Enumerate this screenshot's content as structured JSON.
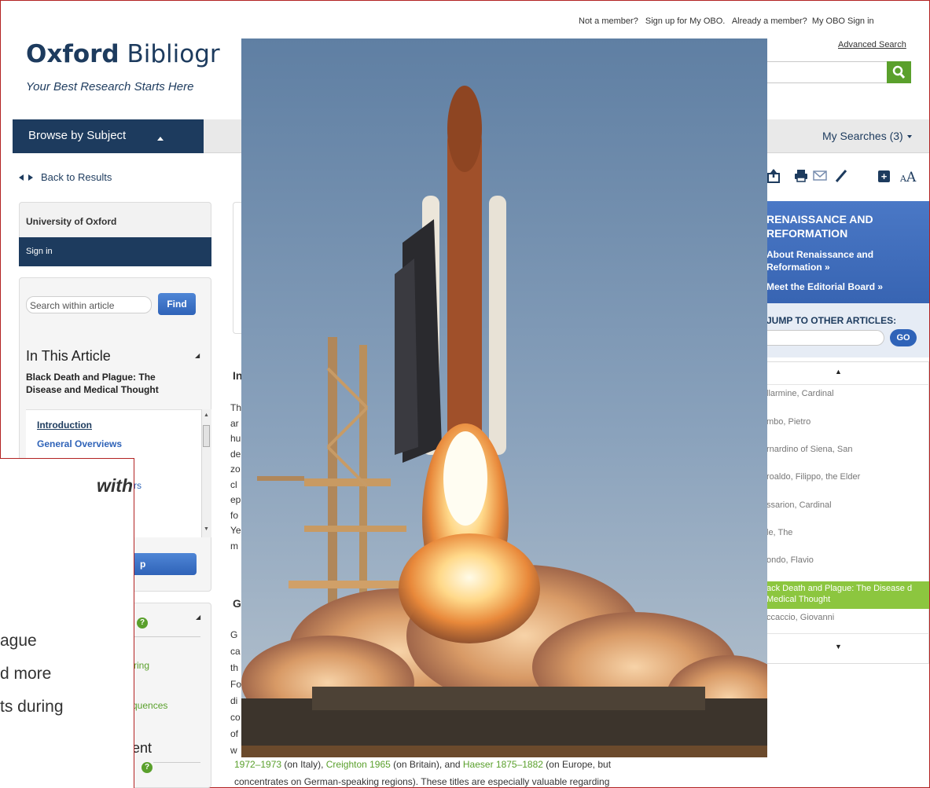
{
  "header": {
    "not_member": "Not a member?",
    "sign_up": "Sign up for My OBO.",
    "already_member": "Already a member?",
    "sign_in": "My OBO Sign in",
    "advanced_search": "Advanced Search",
    "logo_bold": "Oxford",
    "logo_rest": " Bibliogr",
    "tagline": "Your Best Research Starts Here"
  },
  "nav": {
    "browse": "Browse by Subject",
    "my_searches": "My Searches",
    "my_searches_count": "(3)"
  },
  "back_to_results": "Back to Results",
  "sidebar": {
    "institution": "University of Oxford",
    "sign_in": "Sign in",
    "search_placeholder": "Search within article",
    "find": "Find",
    "in_this_article": "In This Article",
    "article_title": "Black Death and Plague: The Disease and Medical Thought",
    "toc": [
      "Introduction",
      "General Overviews"
    ],
    "toc_partial": "rs",
    "button_partial": "p",
    "panel3_ring": "ring",
    "panel3_quences": "quences",
    "panel3_ent": "ent"
  },
  "center": {
    "heading1": "In",
    "letters1": [
      "Th",
      "ar",
      "hu",
      "de",
      "zo",
      "cl",
      "ep",
      "fo",
      "Ye",
      "m"
    ],
    "heading2": "G",
    "letters2": [
      "G",
      "ca",
      "th",
      "Fo",
      "di",
      "co",
      "of",
      "w"
    ],
    "cite": {
      "link1": "1972–1973",
      "t1": " (on Italy), ",
      "link2": "Creighton 1965",
      "t2": " (on Britain), and ",
      "link3": "Haeser 1875–1882",
      "t3": " (on Europe, but"
    },
    "cite_line2": "concentrates on German-speaking regions). These titles are especially valuable regarding"
  },
  "right_panel": {
    "title": "RENAISSANCE AND REFORMATION",
    "about": "About Renaissance and Reformation »",
    "board": "Meet the Editorial Board »",
    "jump": "JUMP TO OTHER ARTICLES:",
    "go": "GO",
    "items": [
      "llarmine, Cardinal",
      "mbo, Pietro",
      "rnardino of Siena, San",
      "roaldo, Filippo, the Elder",
      "ssarion, Cardinal",
      "le, The",
      "ondo, Flavio"
    ],
    "active_item": "ack Death and Plague: The Disease d Medical Thought",
    "after_item": "ccaccio, Giovanni"
  },
  "callout": {
    "with": "with",
    "l1": "ague",
    "l2": "d more",
    "l3": "ts during"
  },
  "colors": {
    "navy": "#1d3b5e",
    "green": "#5aa02c",
    "blue": "#2f63b8",
    "highlight": "#8cc63f",
    "frame": "#b22222"
  },
  "icons": {
    "search": "magnifier-icon",
    "share": "share-icon",
    "print": "printer-icon",
    "email": "envelope-icon",
    "cite": "pencil-icon",
    "save": "plus-icon",
    "font": "text-size-icon",
    "help": "question-icon"
  }
}
